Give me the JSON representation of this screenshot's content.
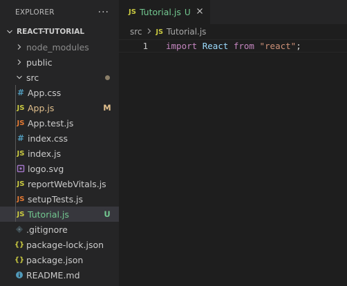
{
  "sidebar": {
    "title": "EXPLORER",
    "more_icon": "more-actions-icon",
    "project": "REACT-TUTORIAL",
    "items": [
      {
        "label": "node_modules",
        "type": "folder",
        "state": "collapsed",
        "level": 1,
        "dim": true
      },
      {
        "label": "public",
        "type": "folder",
        "state": "collapsed",
        "level": 1
      },
      {
        "label": "src",
        "type": "folder",
        "state": "expanded",
        "level": 1,
        "badge_dot": true
      },
      {
        "label": "App.css",
        "type": "css",
        "icon": "#",
        "level": 2
      },
      {
        "label": "App.js",
        "type": "js",
        "icon": "JS",
        "level": 2,
        "status": "M"
      },
      {
        "label": "App.test.js",
        "type": "test",
        "icon": "JS",
        "level": 2
      },
      {
        "label": "index.css",
        "type": "css",
        "icon": "#",
        "level": 2
      },
      {
        "label": "index.js",
        "type": "js",
        "icon": "JS",
        "level": 2
      },
      {
        "label": "logo.svg",
        "type": "svg",
        "icon": "svg",
        "level": 2
      },
      {
        "label": "reportWebVitals.js",
        "type": "js",
        "icon": "JS",
        "level": 2
      },
      {
        "label": "setupTests.js",
        "type": "test",
        "icon": "JS",
        "level": 2
      },
      {
        "label": "Tutorial.js",
        "type": "js",
        "icon": "JS",
        "level": 2,
        "status": "U",
        "selected": true
      },
      {
        "label": ".gitignore",
        "type": "git",
        "icon": "git",
        "level": 1
      },
      {
        "label": "package-lock.json",
        "type": "json",
        "icon": "{}",
        "level": 1
      },
      {
        "label": "package.json",
        "type": "json",
        "icon": "{}",
        "level": 1
      },
      {
        "label": "README.md",
        "type": "info",
        "icon": "i",
        "level": 1
      }
    ]
  },
  "editor": {
    "tab": {
      "icon": "JS",
      "label": "Tutorial.js",
      "status": "U"
    },
    "breadcrumb": {
      "folder": "src",
      "icon": "JS",
      "file": "Tutorial.js"
    },
    "lines": [
      {
        "number": "1",
        "tokens": {
          "kw1": "import",
          "id": "React",
          "kw2": "from",
          "str": "\"react\"",
          "punc": ";"
        }
      }
    ]
  },
  "colors": {
    "sidebar_bg": "#252526",
    "editor_bg": "#1e1e1e",
    "modified": "#e2c08d",
    "untracked": "#73c991",
    "js_icon": "#cbcb41",
    "css_icon": "#519aba",
    "json_icon": "#cbcb41",
    "svg_icon": "#a074c4",
    "git_icon": "#41535b",
    "info_icon": "#519aba",
    "test_icon": "#e37933"
  }
}
